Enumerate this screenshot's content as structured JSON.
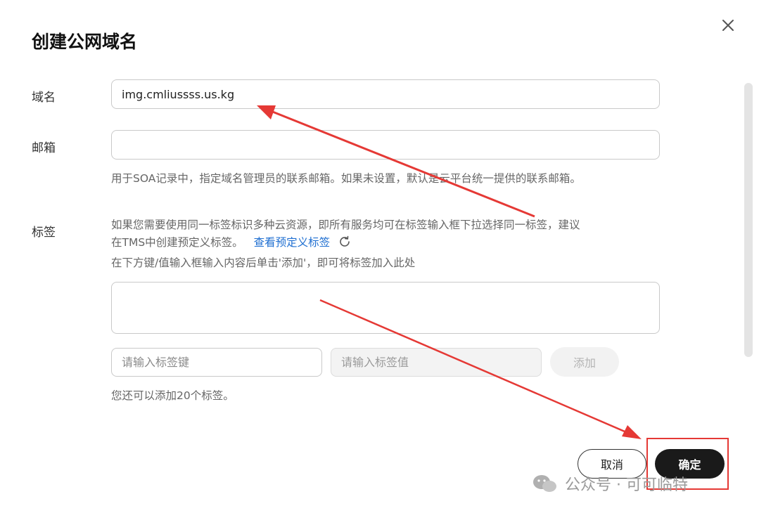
{
  "dialog": {
    "title": "创建公网域名",
    "close_icon": "close-icon"
  },
  "domain": {
    "label": "域名",
    "value": "img.cmliussss.us.kg"
  },
  "email": {
    "label": "邮箱",
    "value": "",
    "hint": "用于SOA记录中，指定域名管理员的联系邮箱。如果未设置，默认是云平台统一提供的联系邮箱。"
  },
  "tags": {
    "label": "标签",
    "desc_line1": "如果您需要使用同一标签标识多种云资源，即所有服务均可在标签输入框下拉选择同一标签，建议",
    "desc_line2_prefix": "在TMS中创建预定义标签。",
    "view_link": "查看预定义标签",
    "desc_line3": "在下方键/值输入框输入内容后单击'添加'，即可将标签加入此处",
    "key_placeholder": "请输入标签键",
    "value_placeholder": "请输入标签值",
    "add_label": "添加",
    "remaining": "您还可以添加20个标签。"
  },
  "footer": {
    "cancel_label": "取消",
    "ok_label": "确定"
  },
  "watermark": {
    "text": "公众号 · 可可临特"
  },
  "colors": {
    "annotation_red": "#e53935",
    "link_blue": "#1f6fd1",
    "primary_button": "#1a1a1a"
  }
}
